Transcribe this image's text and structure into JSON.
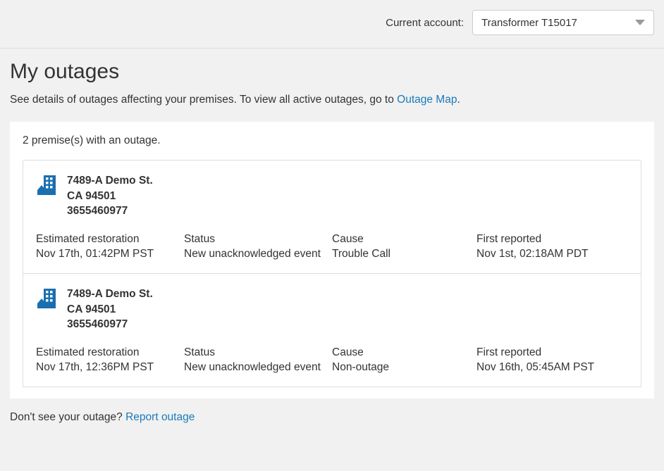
{
  "header": {
    "accountLabel": "Current account:",
    "accountValue": "Transformer T15017"
  },
  "page": {
    "title": "My outages",
    "introPrefix": "See details of outages affecting your premises. To view all active outages, go to ",
    "introLinkText": "Outage Map",
    "introSuffix": "."
  },
  "summary": "2 premise(s) with an outage.",
  "labels": {
    "est": "Estimated restoration",
    "status": "Status",
    "cause": "Cause",
    "reported": "First reported"
  },
  "outages": [
    {
      "address": "7489-A Demo St.",
      "cityzip": "CA 94501",
      "account": "3655460977",
      "est": "Nov 17th, 01:42PM PST",
      "status": "New unacknowledged event",
      "cause": "Trouble Call",
      "reported": "Nov 1st, 02:18AM PDT"
    },
    {
      "address": "7489-A Demo St.",
      "cityzip": "CA 94501",
      "account": "3655460977",
      "est": "Nov 17th, 12:36PM PST",
      "status": "New unacknowledged event",
      "cause": "Non-outage",
      "reported": "Nov 16th, 05:45AM PST"
    }
  ],
  "footer": {
    "prefix": "Don't see your outage? ",
    "linkText": "Report outage"
  }
}
